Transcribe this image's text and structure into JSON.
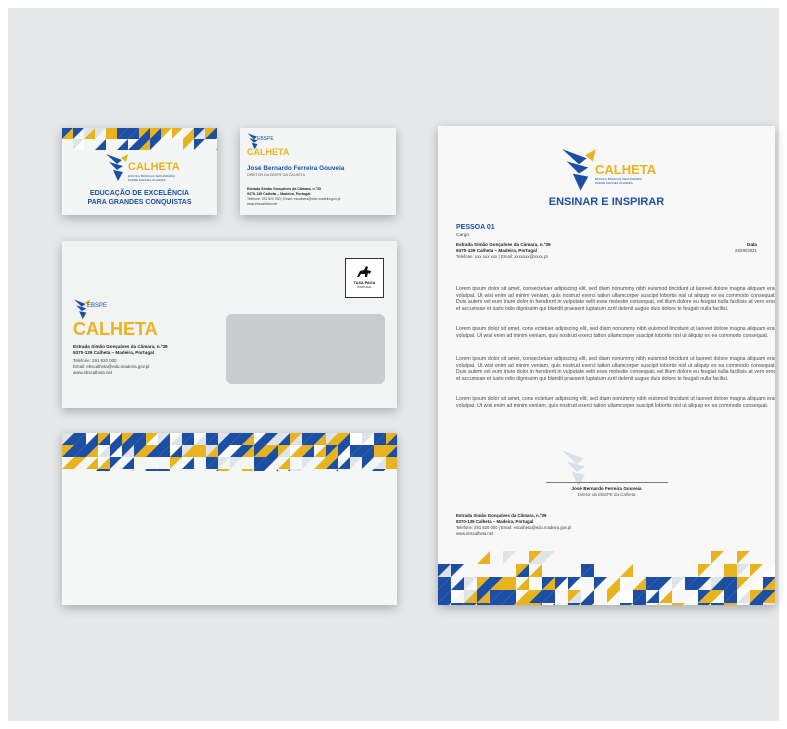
{
  "brand": {
    "small": "EBSPE",
    "name": "CALHETA",
    "sub1": "ESCOLA BÁSICA E SECUNDÁRIA",
    "sub2": "PADRE MANUEL ÁLVARES"
  },
  "card_front": {
    "tagline1": "EDUCAÇÃO DE EXCELÊNCIA",
    "tagline2": "PARA GRANDES CONQUISTAS"
  },
  "card_back": {
    "person": "José Bernardo Ferreira Gouveia",
    "role": "DIRETOR DA EBSPE DA CALHETA",
    "address1": "Estrada Simão Gonçalves da Câmara, n.º39",
    "address2": "9370-139 Calheta – Madeira, Portugal",
    "contacts": "Telefone: 291 820 000 | Email: escalheta@edu.madeira.gov.pt",
    "web": "www.ebscalheta.net"
  },
  "envelope_window": {
    "address1": "Estrada Simão Gonçalves da Câmara, n.º39",
    "address2": "9370-139 Calheta – Madeira, Portugal",
    "phone": "Telefone: 291 820 000",
    "email": "Email: ebscalheta@edu.madeira.gov.pt",
    "web": "www.ebscalheta.net",
    "stamp_line1": "TAXA PAGA",
    "stamp_line2": "PORTUGAL"
  },
  "letter": {
    "slogan": "ENSINAR E INSPIRAR",
    "recipient": "PESSOA 01",
    "recipient_role": "Cargo",
    "address1": "Estrada Simão Gonçalves da Câmara, n.º39",
    "address2": "9370-139 Calheta – Madeira, Portugal",
    "contacts": "Telefone: xxx xxx xxx | Email: xxxxxxx@xxxx.pt",
    "date_label": "Data",
    "date_value": "25/09/2021",
    "para1": "Lorem ipsum dolor sit amet, consectetuer adipiscing elit, sed diam nonummy nibh euismod tincidunt ut laoreet dolore magna aliquam erat volutpat. Ut wisi enim ad minim veniam, quis nostrud exerci tation ullamcorper suscipit lobortis nisl ut aliquip ex ea commodo consequat. Duis autem vel eum iriure dolor in hendrerit in vulputate velit esse molestie consequat, vel illum dolore eu feugiat nulla facilisis at vero eros et accumsan et iusto odio dignissim qui blandit praesent luptatum zzril delenit augue duis dolore te feugait nulla facilisi.",
    "para2": "Lorem ipsum dolor sit amet, cons ectetuer adipiscing elit, sed diam nonummy nibh euismod tincidunt ut laoreet dolore magna aliquam erat volutpat. Ut wisi enim ad minim veniam, quis nostrud exerci tation ullamcorper suscipit lobortis nisl ut aliquip ex ea commodo consequat.",
    "para3": "Lorem ipsum dolor sit amet, consectetuer adipiscing elit, sed diam nonummy nibh euismod tincidunt ut laoreet dolore magna aliquam erat volutpat. Ut wisi enim ad minim veniam, quis nostrud exerci tation ullamcorper suscipit lobortis nisl ut aliquip ex ea commodo consequat. Duis autem vel eum iriure dolor in hendrerit in vulputate velit esse molestie consequat, vel illum dolore eu feugiat nulla facilisis at vero eros et accumsan et iusto odio dignissim qui blandit praesent luptatum zzril delenit augue duis dolore te feugait nulla facilisi.",
    "para4": "Lorem ipsum dolor sit amet, cons ectetuer adipiscing elit, sed diam nonummy nibh euismod tincidunt ut laoreet dolore magna aliquam erat volutpat. Ut wisi enim ad minim veniam, quis nostrud exerci tation ullamcorper suscipit lobortis nisl ut aliquip ex ea commodo consequat.",
    "signer": "José Bernardo Ferreira Gouveia",
    "signer_role": "Diretor da EBSPE da Calheta",
    "footer_address1": "Estrada Simão Gonçalves da Câmara, n.º39",
    "footer_address2": "9370-139 Calheta – Madeira, Portugal",
    "footer_contacts": "Telefone: 291 820 000 | Email: escalheta@edu.madeira.gov.pt",
    "footer_web": "www.ebscalheta.net"
  },
  "colors": {
    "brand_blue": "#1c4fa3",
    "brand_yellow": "#e9b31d",
    "background": "#e6e8ea"
  }
}
